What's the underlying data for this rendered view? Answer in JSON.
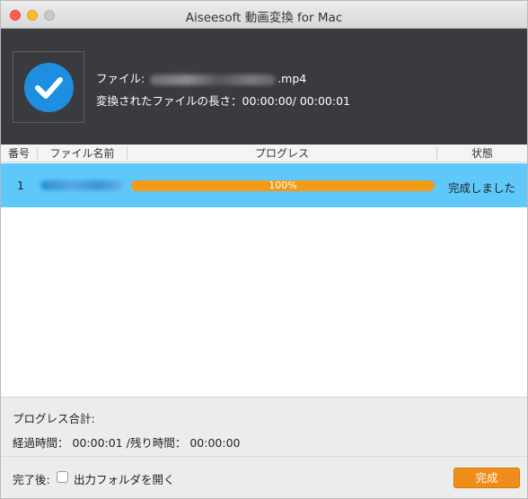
{
  "window": {
    "title": "Aiseesoft 動画変換 for Mac"
  },
  "header": {
    "file_label": "ファイル:",
    "file_ext": ".mp4",
    "duration_label": "変換されたファイルの長さ：",
    "duration_value": "00:00:00/ 00:00:01",
    "status_icon": "check-icon",
    "accent_color": "#1e8fe0"
  },
  "table": {
    "columns": [
      "番号",
      "ファイル名前",
      "プログレス",
      "状態"
    ],
    "rows": [
      {
        "number": "1",
        "progress_text": "100%",
        "progress_fraction": 1.0,
        "status": "完成しました"
      }
    ],
    "selection_color": "#5ec8fb",
    "progress_color": "#f39a16"
  },
  "summary": {
    "total_label": "プログレス合計:",
    "elapsed_label": "経過時間：",
    "elapsed_value": "00:00:01",
    "remaining_label": "/残り時間：",
    "remaining_value": "00:00:00"
  },
  "footer": {
    "after_label": "完了後:",
    "open_folder_label": "出力フォルダを開く",
    "open_folder_checked": false,
    "done_button": "完成",
    "button_color": "#f08c1a"
  }
}
